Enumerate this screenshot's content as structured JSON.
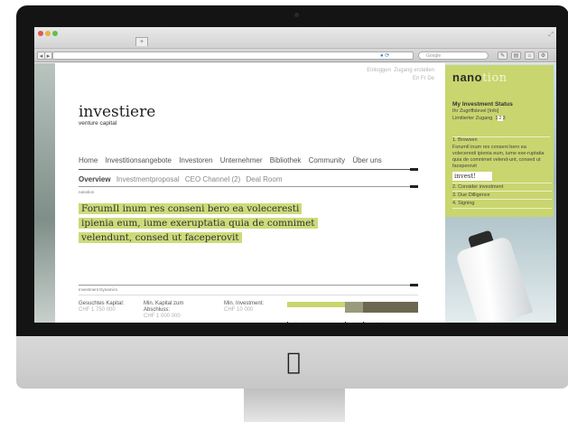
{
  "browser": {
    "search_placeholder": "Google"
  },
  "page": {
    "login_link": "Einloggen",
    "signup_link": "Zugang erstellen",
    "languages": [
      "En",
      "Fr",
      "De"
    ],
    "brand": "investiere",
    "brand_sub": "venture capital",
    "main_nav": [
      "Home",
      "Investitionsangebote",
      "Investoren",
      "Unternehmer",
      "Bibliothek",
      "Community",
      "Über uns"
    ],
    "sub_nav_active": "Overview",
    "sub_nav": [
      "Investmentproposal",
      "CEO Channel (2)",
      "Deal Room"
    ],
    "tag": "nanotion",
    "headline_lines": [
      "ForumIl inum res conseni bero ea voleceresti",
      "ipienia eum, iume exeruptatia quia de comnimet",
      "velendunt, consed ut faceperovit"
    ],
    "dynamics_label": "Investment Dynamics",
    "stats": [
      {
        "label": "Gesuchtes Kapital:",
        "value": "CHF 1 750 000"
      },
      {
        "label": "Min. Kapital zum Abschluss:",
        "value": "CHF 1 000 000"
      },
      {
        "label": "Min. Investment:",
        "value": "CHF 10 000"
      }
    ],
    "progress": {
      "total_label": "total",
      "total_value": "1600000",
      "interested_label": "interested",
      "interested_value": "891000",
      "committed_label": "committed",
      "committed_value": "677000",
      "color_total": "#c9d56e",
      "color_interested": "#9a9a7c",
      "color_committed": "#6d6650"
    }
  },
  "panel": {
    "logo_bold": "nano",
    "logo_rest": "tion",
    "title": "My Investment Status",
    "access_line": "Ihr Zugriffslevel",
    "access_info": "[Info]",
    "limited": "Limitierter Zugang",
    "levels": [
      "1",
      "2",
      "3"
    ],
    "step1": "1. Browsen",
    "step1_text": "ForumIl inum res conseni bero ea voleceresti ipienia eum, iume exe-ruptatia quia de comnimet velend-unt, consed ut faceperovit",
    "invest_button": "invest!",
    "steps": [
      "2. Consider investment",
      "3. Due Dilligence",
      "4. Signing"
    ],
    "color": "#c9d56e"
  },
  "device": {
    "logo_icon": "apple-logo-icon"
  }
}
